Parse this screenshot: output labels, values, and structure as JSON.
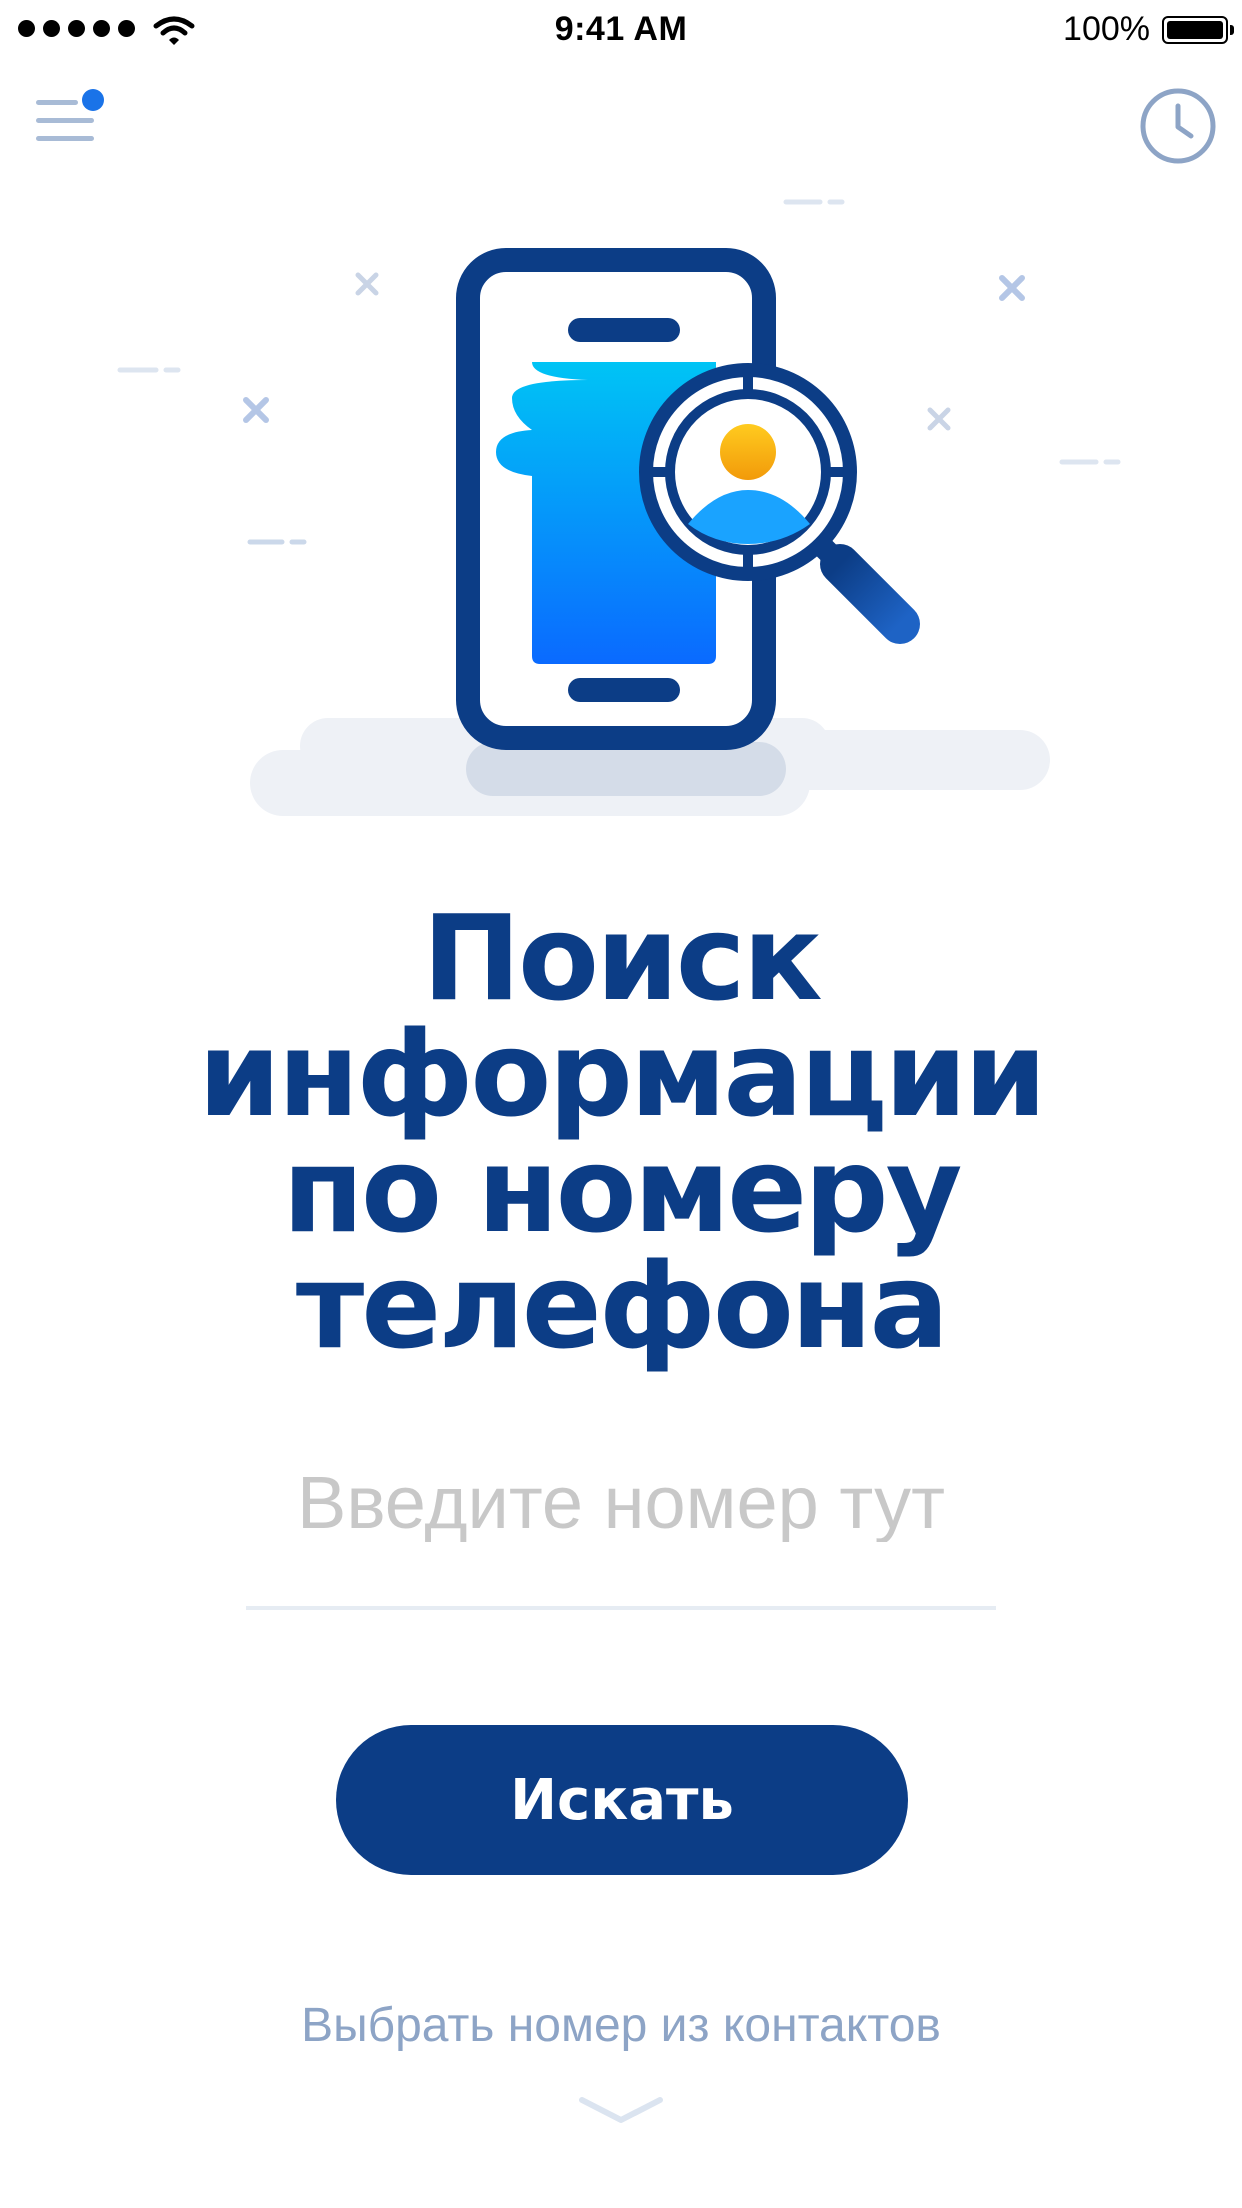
{
  "status_bar": {
    "time": "9:41 AM",
    "battery_percent": "100%",
    "signal_icon": "cellular-signal-icon",
    "wifi_icon": "wifi-icon",
    "battery_icon": "battery-icon"
  },
  "header": {
    "menu_icon": "menu-icon",
    "notification_dot_color": "#1a73e8",
    "history_icon": "clock-icon"
  },
  "illustration": {
    "name": "phone-search-illustration"
  },
  "title_lines": [
    "Поиск",
    "информации",
    "по номеру",
    "телефона"
  ],
  "search": {
    "placeholder": "Введите номер тут",
    "value": "",
    "button_label": "Искать"
  },
  "contacts": {
    "link_label": "Выбрать номер из контактов",
    "chevron_icon": "chevron-down-icon"
  },
  "colors": {
    "brand": "#0c3d86",
    "accent": "#1a73e8",
    "muted": "#8da4c6",
    "placeholder": "#c8c8c8"
  }
}
